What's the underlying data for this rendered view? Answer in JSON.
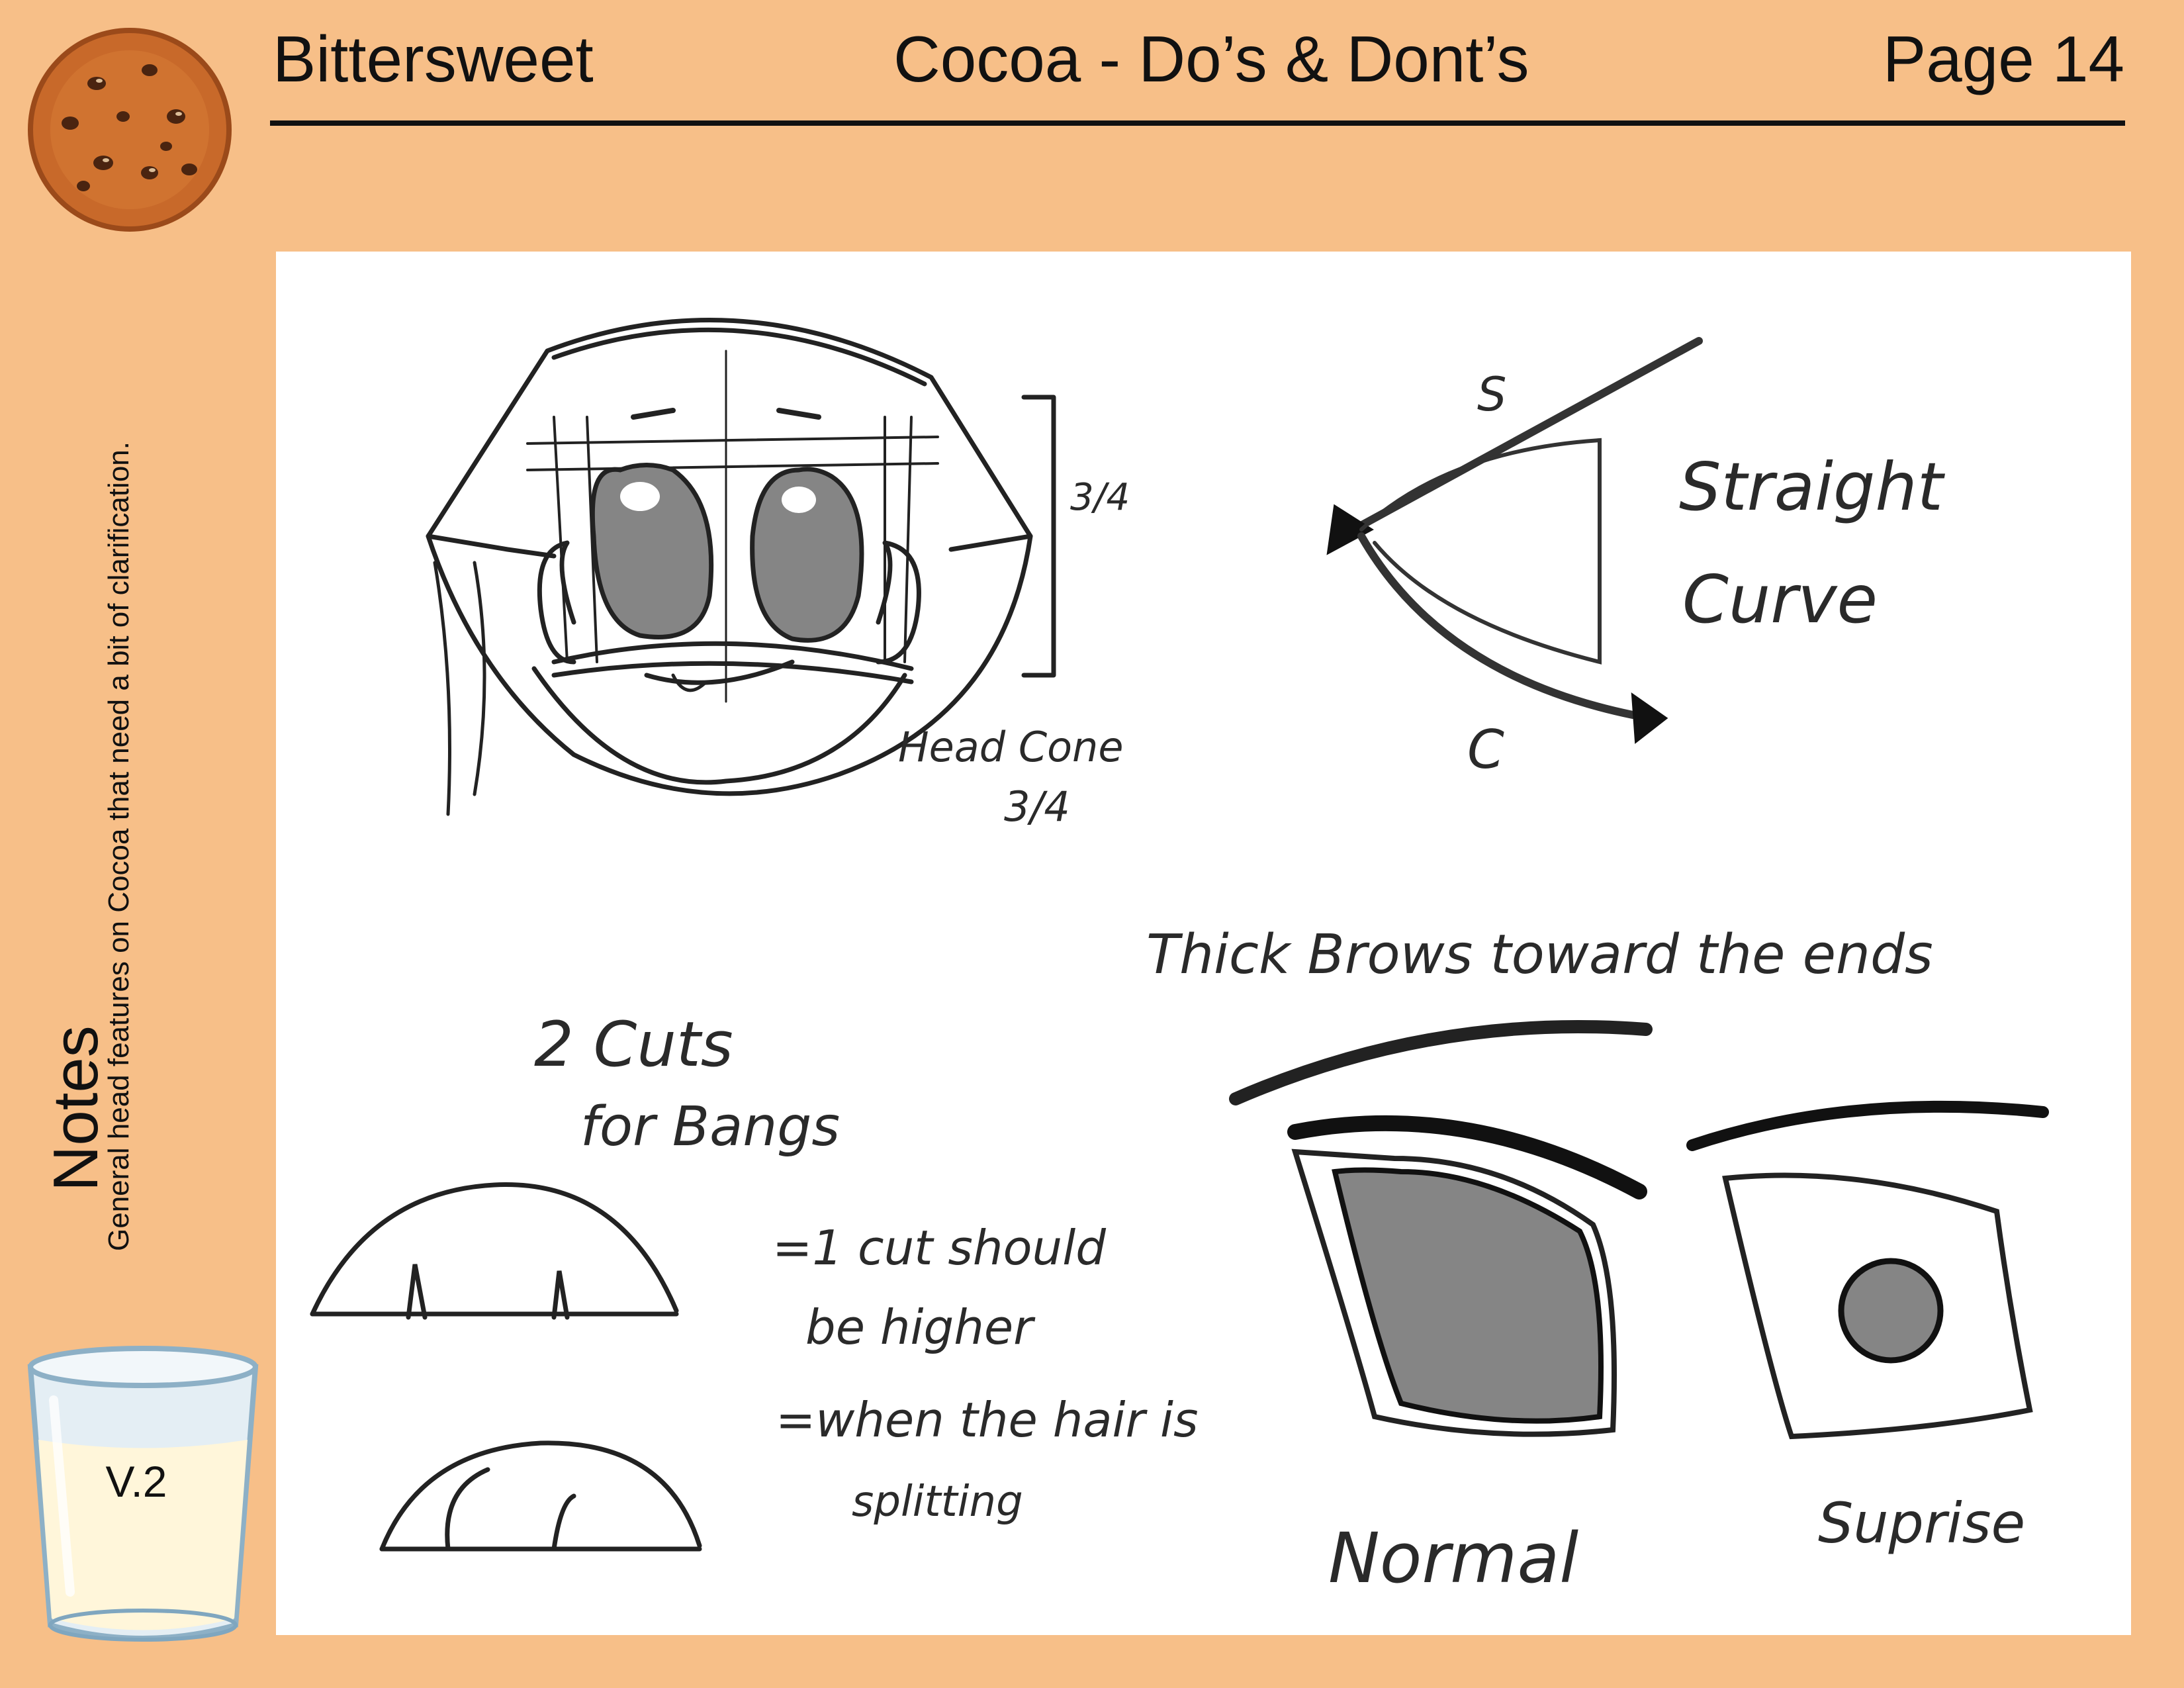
{
  "header": {
    "left": "Bittersweet",
    "center": "Cocoa - Do’s & Dont’s",
    "right": "Page 14"
  },
  "sidebar": {
    "notes_title": "Notes",
    "notes_description": "General head features on Cocoa that need a bit of clarification.",
    "version": "V.2"
  },
  "icons": {
    "top_left": "cookie-icon",
    "bottom_left": "milk-glass-icon"
  },
  "sketch_labels": {
    "ratio": "3/4",
    "head_cone": "Head Cone",
    "head_cone_ratio": "3/4",
    "s_letter": "S",
    "c_letter": "C",
    "straight": "Straight",
    "curve": "Curve",
    "brows_note": "Thick Brows toward the ends",
    "cuts_line1": "2 Cuts",
    "cuts_line2": "for Bangs",
    "cut_note_1a": "=1 cut should",
    "cut_note_1b": "be higher",
    "cut_note_2a": "=when the hair is",
    "cut_note_2b": "splitting",
    "normal": "Normal",
    "surprise": "Suprise"
  },
  "colors": {
    "background": "#F7BF88",
    "panel": "#ffffff",
    "ink": "#111111",
    "eye_fill": "#858585",
    "cookie": "#C8692A",
    "chip": "#4a2410",
    "milk": "#FFF6DA",
    "glass": "#B8D3E3"
  }
}
